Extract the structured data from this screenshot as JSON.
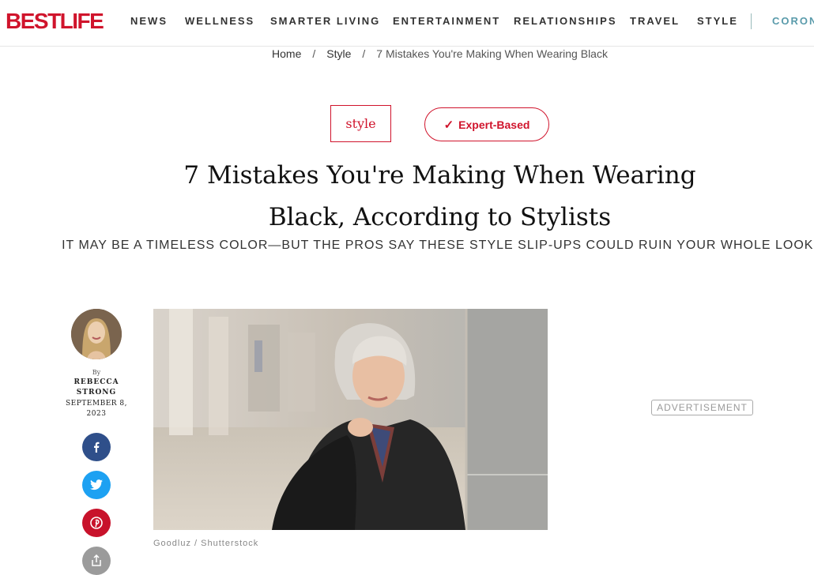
{
  "header": {
    "logo": "BESTLIFE",
    "nav": [
      "NEWS",
      "WELLNESS",
      "SMARTER LIVING",
      "ENTERTAINMENT",
      "RELATIONSHIPS",
      "TRAVEL",
      "STYLE"
    ],
    "nav_extra": "CORON"
  },
  "breadcrumb": {
    "home": "Home",
    "section": "Style",
    "current": "7 Mistakes You're Making When Wearing Black",
    "separator": "/"
  },
  "tags": {
    "category": "style",
    "badge_icon": "check-icon",
    "badge": "Expert-Based"
  },
  "article": {
    "title_line1": "7 Mistakes You're Making When Wearing",
    "title_line2": "Black, According to Stylists",
    "dek": "IT MAY BE A TIMELESS COLOR—BUT THE PROS SAY THESE STYLE SLIP-UPS COULD RUIN YOUR WHOLE LOOK.",
    "image_caption": "Goodluz / Shutterstock"
  },
  "author": {
    "by": "By",
    "name_line1": "REBECCA",
    "name_line2": "STRONG",
    "date_line1": "SEPTEMBER 8,",
    "date_line2": "2023"
  },
  "share": {
    "icons": [
      "facebook-icon",
      "twitter-icon",
      "pinterest-icon",
      "share-icon"
    ]
  },
  "ad": {
    "label": "ADVERTISEMENT"
  },
  "colors": {
    "brand_red": "#d0142c",
    "facebook": "#2f4f8a",
    "twitter": "#1da1f2",
    "pinterest": "#c8122b",
    "share": "#9b9b9b",
    "nav_accent": "#5a9bab"
  }
}
